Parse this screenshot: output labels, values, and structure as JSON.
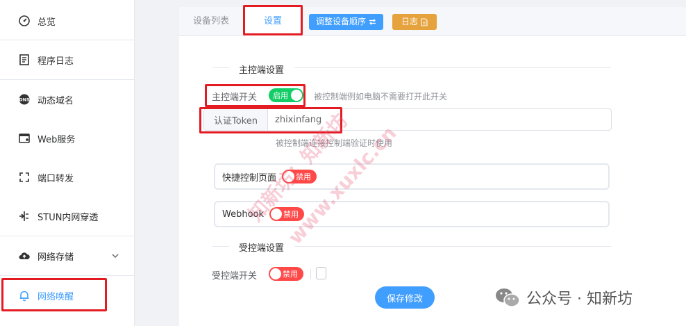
{
  "sidebar": {
    "items": [
      {
        "label": "总览",
        "icon": "dashboard-icon"
      },
      {
        "label": "程序日志",
        "icon": "log-icon"
      },
      {
        "label": "动态域名",
        "icon": "dns-icon"
      },
      {
        "label": "Web服务",
        "icon": "web-service-icon"
      },
      {
        "label": "端口转发",
        "icon": "port-forward-icon"
      },
      {
        "label": "STUN内网穿透",
        "icon": "stun-icon"
      },
      {
        "label": "网络存储",
        "icon": "cloud-storage-icon"
      },
      {
        "label": "网络唤醒",
        "icon": "bell-icon"
      }
    ]
  },
  "tabs": {
    "device_list": "设备列表",
    "settings": "设置",
    "reorder_button": "调整设备顺序",
    "log_button": "日志"
  },
  "master": {
    "section_title": "主控端设置",
    "switch_label": "主控端开关",
    "switch_text": "启用",
    "switch_hint": "被控制端例如电脑不需要打开此开关",
    "token_label": "认证Token",
    "token_value": "zhixinfang",
    "token_hint": "被控制端连接控制端验证时使用",
    "quick_page_label": "快捷控制页面",
    "quick_page_switch": "禁用",
    "webhook_label": "Webhook",
    "webhook_switch": "禁用"
  },
  "slave": {
    "section_title": "受控端设置",
    "switch_label": "受控端开关",
    "switch_text": "禁用"
  },
  "save_button": "保存修改",
  "watermark": {
    "line1": "知新坊：知新坊",
    "line2": "www.xuxlc.cn"
  },
  "wechat": {
    "text": "公众号 · 知新坊"
  },
  "colors": {
    "primary": "#409eff",
    "success": "#13ce66",
    "danger": "#ff4949",
    "warning": "#e6a23c",
    "highlight": "#e31b23"
  }
}
